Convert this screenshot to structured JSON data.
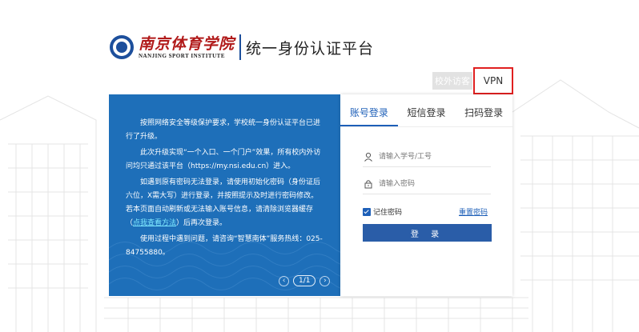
{
  "header": {
    "logo_cn": "南京体育学院",
    "logo_en": "NANJING SPORT INSTITUTE",
    "system_title": "统一身份认证平台"
  },
  "top_links": {
    "campus_visitor": "校外访客",
    "vpn": "VPN"
  },
  "notice": {
    "paragraphs": [
      "按照网络安全等级保护要求，学校统一身份认证平台已进行了升级。",
      "此次升级实现“一个入口、一个门户”效果，所有校内外访问均只通过该平台（https://my.nsi.edu.cn）进入。",
      "如遇到原有密码无法登录，请使用初始化密码（身份证后六位，X需大写）进行登录，并按照提示及时进行密码修改。若本页面自动刷新或无法输入账号信息，请清除浏览器缓存（",
      "）后再次登录。",
      "使用过程中遇到问题，请咨询“智慧南体”服务热线：025-84755880。"
    ],
    "inline_link": "点我查看方法",
    "pager": {
      "prev": "‹",
      "page": "1/1",
      "next": "›"
    }
  },
  "login": {
    "tabs": [
      "账号登录",
      "短信登录",
      "扫码登录"
    ],
    "active_tab": 0,
    "username": {
      "value": "",
      "placeholder": "请输入学号/工号"
    },
    "password": {
      "value": "",
      "placeholder": "请输入密码"
    },
    "remember_label": "记住密码",
    "remember_checked": true,
    "reset_password": "重置密码",
    "submit": "登 录"
  },
  "colors": {
    "brand_blue": "#1e6fb9",
    "button_blue": "#2a5da8",
    "logo_red": "#b11a1a",
    "highlight_red": "#e02020"
  }
}
